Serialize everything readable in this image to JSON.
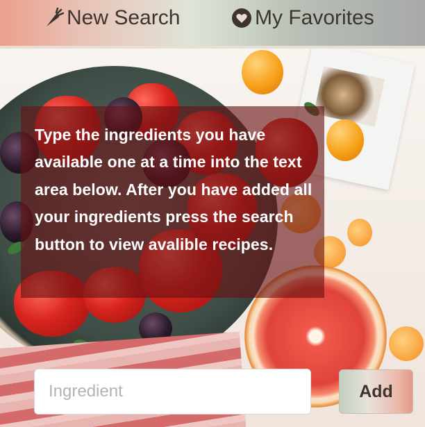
{
  "nav": {
    "new_search_label": "New Search",
    "new_search_icon": "carrot-icon",
    "favorites_label": "My Favorites",
    "favorites_icon": "heart-icon"
  },
  "instructions": {
    "text": "Type the ingredients you have available one at a time into the text area below. After you have added all your ingredients press the search button to view avalible recipes."
  },
  "ingredient_form": {
    "input_placeholder": "Ingredient",
    "input_value": "",
    "add_label": "Add"
  },
  "colors": {
    "nav_text": "#3e332e",
    "panel_overlay": "#681214",
    "panel_text": "#ffffff"
  }
}
